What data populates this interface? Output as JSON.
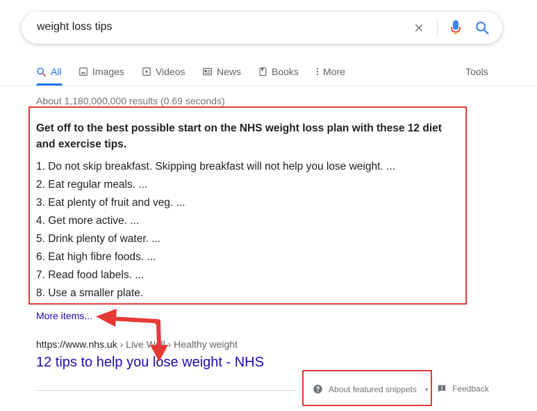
{
  "search": {
    "query": "weight loss tips"
  },
  "tabs": [
    {
      "label": "All",
      "icon": "search-icon",
      "active": true
    },
    {
      "label": "Images",
      "icon": "image-icon"
    },
    {
      "label": "Videos",
      "icon": "video-icon"
    },
    {
      "label": "News",
      "icon": "news-icon"
    },
    {
      "label": "Books",
      "icon": "book-icon"
    },
    {
      "label": "More",
      "icon": "more-vert-icon"
    }
  ],
  "tools_label": "Tools",
  "stats": "About 1,180,000,000 results (0.69 seconds)",
  "snippet": {
    "heading": "Get off to the best possible start on the NHS weight loss plan with these 12 diet and exercise tips.",
    "items": [
      "1. Do not skip breakfast. Skipping breakfast will not help you lose weight. ...",
      "2. Eat regular meals. ...",
      "3. Eat plenty of fruit and veg. ...",
      "4. Get more active. ...",
      "5. Drink plenty of water. ...",
      "6. Eat high fibre foods. ...",
      "7. Read food labels. ...",
      "8. Use a smaller plate."
    ],
    "more_items": "More items..."
  },
  "result": {
    "url": "https://www.nhs.uk",
    "breadcrumb": " › Live Well › Healthy weight",
    "title": "12 tips to help you lose weight - NHS"
  },
  "footer": {
    "about_label": "About featured snippets",
    "separator": "•",
    "feedback_label": "Feedback"
  },
  "colors": {
    "link": "#1a0dab",
    "accent": "#1a73e8",
    "annotation": "#e53935"
  }
}
